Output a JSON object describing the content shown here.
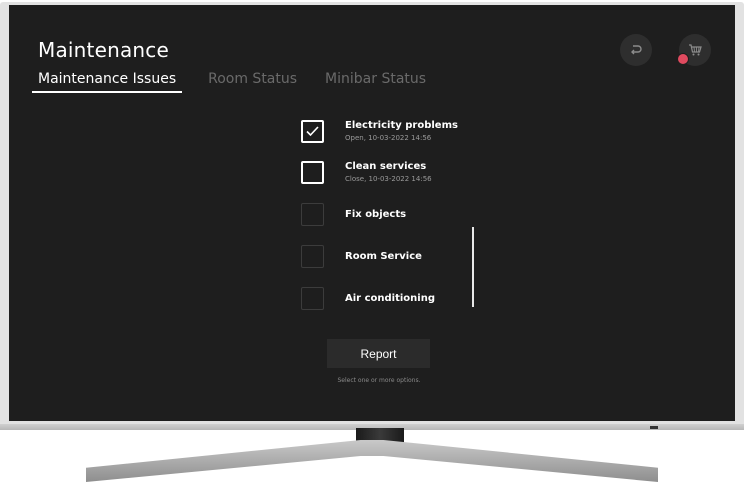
{
  "header": {
    "title": "Maintenance",
    "tabs": [
      {
        "label": "Maintenance Issues",
        "active": true
      },
      {
        "label": "Room Status",
        "active": false
      },
      {
        "label": "Minibar Status",
        "active": false
      }
    ],
    "back_icon": "back-arrow-icon",
    "cart_icon": "cart-icon",
    "badge_color": "#e04a5f"
  },
  "options": [
    {
      "label": "Electricity problems",
      "status": "Open, 10-03-2022 14:56",
      "checked": true
    },
    {
      "label": "Clean services",
      "status": "Close, 10-03-2022 14:56",
      "checked": false
    },
    {
      "label": "Fix objects",
      "status": "",
      "checked": false
    },
    {
      "label": "Room Service",
      "status": "",
      "checked": false
    },
    {
      "label": "Air conditioning",
      "status": "",
      "checked": false
    }
  ],
  "report": {
    "button_label": "Report",
    "hint": "Select one or more options."
  }
}
